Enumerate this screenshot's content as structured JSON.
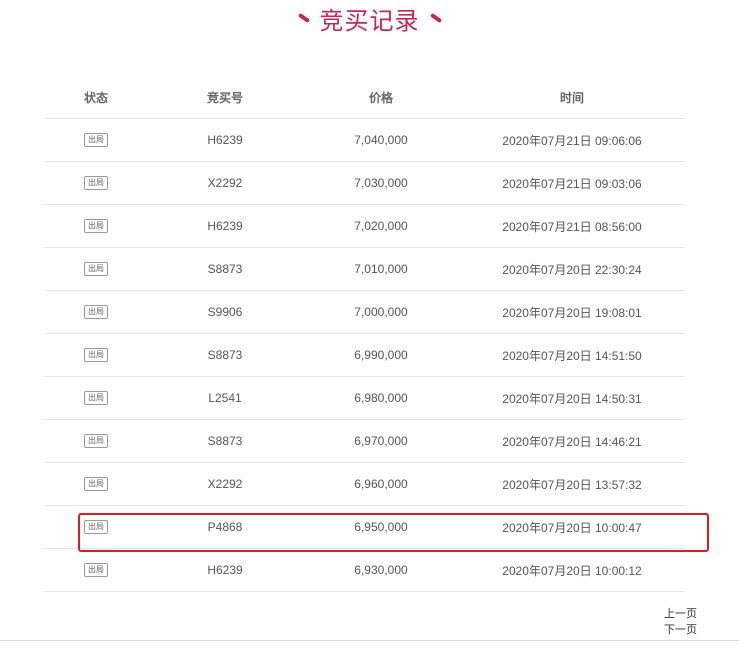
{
  "title": "竞买记录",
  "table": {
    "headers": [
      "状态",
      "竞买号",
      "价格",
      "时间"
    ],
    "rows": [
      {
        "status": "出局",
        "bid_no": "H6239",
        "price": "7,040,000",
        "time": "2020年07月21日 09:06:06"
      },
      {
        "status": "出局",
        "bid_no": "X2292",
        "price": "7,030,000",
        "time": "2020年07月21日 09:03:06"
      },
      {
        "status": "出局",
        "bid_no": "H6239",
        "price": "7,020,000",
        "time": "2020年07月21日 08:56:00"
      },
      {
        "status": "出局",
        "bid_no": "S8873",
        "price": "7,010,000",
        "time": "2020年07月20日 22:30:24"
      },
      {
        "status": "出局",
        "bid_no": "S9906",
        "price": "7,000,000",
        "time": "2020年07月20日 19:08:01"
      },
      {
        "status": "出局",
        "bid_no": "S8873",
        "price": "6,990,000",
        "time": "2020年07月20日 14:51:50"
      },
      {
        "status": "出局",
        "bid_no": "L2541",
        "price": "6,980,000",
        "time": "2020年07月20日 14:50:31"
      },
      {
        "status": "出局",
        "bid_no": "S8873",
        "price": "6,970,000",
        "time": "2020年07月20日 14:46:21"
      },
      {
        "status": "出局",
        "bid_no": "X2292",
        "price": "6,960,000",
        "time": "2020年07月20日 13:57:32"
      },
      {
        "status": "出局",
        "bid_no": "P4868",
        "price": "6,950,000",
        "time": "2020年07月20日 10:00:47"
      },
      {
        "status": "出局",
        "bid_no": "H6239",
        "price": "6,930,000",
        "time": "2020年07月20日 10:00:12"
      }
    ]
  },
  "pager": {
    "prev": "上一页",
    "next": "下一页"
  },
  "colors": {
    "title": "#c8264f",
    "highlight": "#e01b1b"
  }
}
